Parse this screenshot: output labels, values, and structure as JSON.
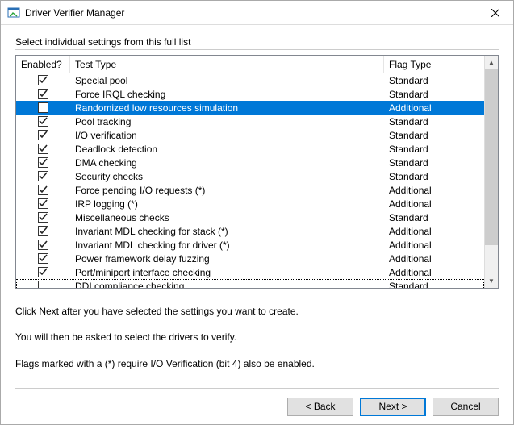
{
  "window": {
    "title": "Driver Verifier Manager"
  },
  "group": {
    "label": "Select individual settings from this full list"
  },
  "columns": {
    "enabled": "Enabled?",
    "test_type": "Test Type",
    "flag_type": "Flag Type"
  },
  "rows": [
    {
      "checked": true,
      "test_type": "Special pool",
      "flag_type": "Standard",
      "selected": false,
      "focus": false
    },
    {
      "checked": true,
      "test_type": "Force IRQL checking",
      "flag_type": "Standard",
      "selected": false,
      "focus": false
    },
    {
      "checked": false,
      "test_type": "Randomized low resources simulation",
      "flag_type": "Additional",
      "selected": true,
      "focus": false
    },
    {
      "checked": true,
      "test_type": "Pool tracking",
      "flag_type": "Standard",
      "selected": false,
      "focus": false
    },
    {
      "checked": true,
      "test_type": "I/O verification",
      "flag_type": "Standard",
      "selected": false,
      "focus": false
    },
    {
      "checked": true,
      "test_type": "Deadlock detection",
      "flag_type": "Standard",
      "selected": false,
      "focus": false
    },
    {
      "checked": true,
      "test_type": "DMA checking",
      "flag_type": "Standard",
      "selected": false,
      "focus": false
    },
    {
      "checked": true,
      "test_type": "Security checks",
      "flag_type": "Standard",
      "selected": false,
      "focus": false
    },
    {
      "checked": true,
      "test_type": "Force pending I/O requests (*)",
      "flag_type": "Additional",
      "selected": false,
      "focus": false
    },
    {
      "checked": true,
      "test_type": "IRP logging (*)",
      "flag_type": "Additional",
      "selected": false,
      "focus": false
    },
    {
      "checked": true,
      "test_type": "Miscellaneous checks",
      "flag_type": "Standard",
      "selected": false,
      "focus": false
    },
    {
      "checked": true,
      "test_type": "Invariant MDL checking for stack (*)",
      "flag_type": "Additional",
      "selected": false,
      "focus": false
    },
    {
      "checked": true,
      "test_type": "Invariant MDL checking for driver (*)",
      "flag_type": "Additional",
      "selected": false,
      "focus": false
    },
    {
      "checked": true,
      "test_type": "Power framework delay fuzzing",
      "flag_type": "Additional",
      "selected": false,
      "focus": false
    },
    {
      "checked": true,
      "test_type": "Port/miniport interface checking",
      "flag_type": "Additional",
      "selected": false,
      "focus": false
    },
    {
      "checked": false,
      "test_type": "DDI compliance checking",
      "flag_type": "Standard",
      "selected": false,
      "focus": true
    }
  ],
  "notes": {
    "line1": "Click Next after you have selected the settings you want to create.",
    "line2": "You will then be asked to select the drivers to verify.",
    "line3": "Flags marked with a (*) require I/O Verification (bit 4) also be enabled."
  },
  "buttons": {
    "back": "< Back",
    "next": "Next >",
    "cancel": "Cancel"
  }
}
